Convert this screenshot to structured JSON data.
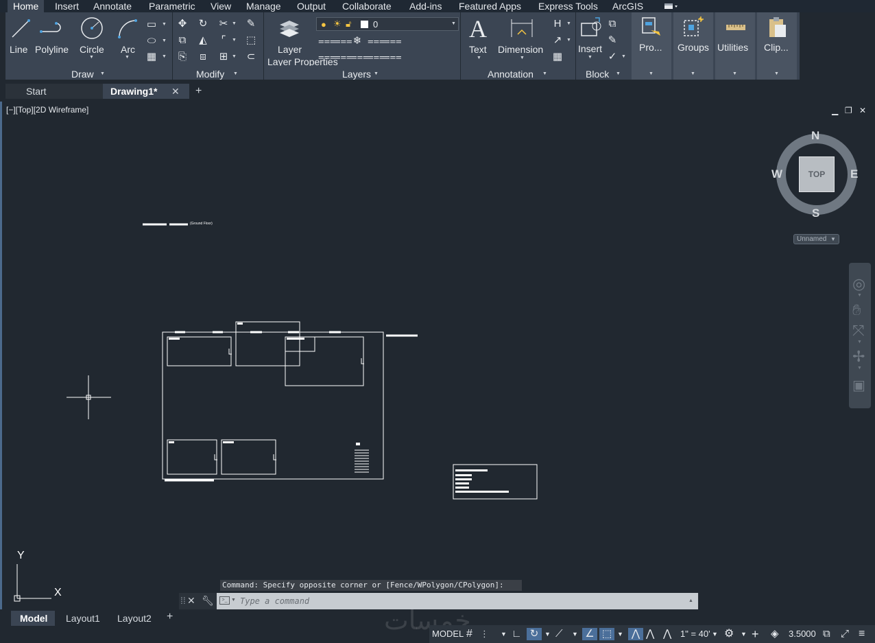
{
  "menu": {
    "tabs": [
      "Home",
      "Insert",
      "Annotate",
      "Parametric",
      "View",
      "Manage",
      "Output",
      "Collaborate",
      "Add-ins",
      "Featured Apps",
      "Express Tools",
      "ArcGIS"
    ],
    "active": "Home"
  },
  "ribbon": {
    "draw": {
      "title": "Draw",
      "line": "Line",
      "polyline": "Polyline",
      "circle": "Circle",
      "arc": "Arc"
    },
    "modify": {
      "title": "Modify"
    },
    "layers": {
      "layer_properties": "Layer Properties",
      "title": "Layers",
      "current_layer": "0"
    },
    "annotation": {
      "text": "Text",
      "dimension": "Dimension",
      "title": "Annotation"
    },
    "block": {
      "insert": "Insert",
      "title": "Block"
    },
    "properties": "Pro...",
    "groups": "Groups",
    "utilities": "Utilities",
    "clipboard": "Clip..."
  },
  "doc_tabs": {
    "start": "Start",
    "drawing": "Drawing1*"
  },
  "viewport": {
    "label": "[−][Top][2D Wireframe]",
    "drawing_title": "(Ground Floor)",
    "viewcube": {
      "face": "TOP",
      "n": "N",
      "s": "S",
      "e": "E",
      "w": "W",
      "ucs_menu": "Unnamed"
    },
    "ucs": {
      "x": "X",
      "y": "Y"
    }
  },
  "command": {
    "history": "Command: Specify opposite corner or [Fence/WPolygon/CPolygon]:",
    "placeholder": "Type a command"
  },
  "layout_tabs": [
    "Model",
    "Layout1",
    "Layout2"
  ],
  "status_bar": {
    "model": "MODEL",
    "scale": "1\" = 40'",
    "annotation_value": "3.5000"
  },
  "watermark": "خمسات",
  "colors": {
    "background": "#212830",
    "ribbon": "#3b4553",
    "accent": "#4b6f9a",
    "geometry": "#ffffff"
  }
}
